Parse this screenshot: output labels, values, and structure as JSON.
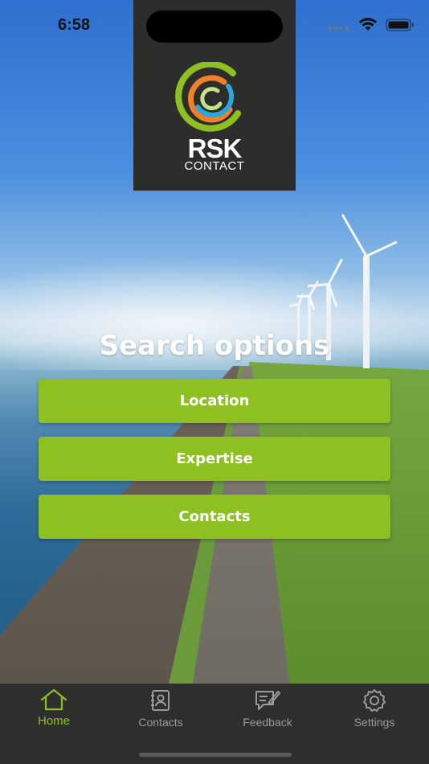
{
  "status_bar": {
    "time": "6:58"
  },
  "brand": {
    "line1": "RSK",
    "line2": "CONTACT"
  },
  "search": {
    "title": "Search options",
    "buttons": [
      {
        "label": "Location"
      },
      {
        "label": "Expertise"
      },
      {
        "label": "Contacts"
      }
    ]
  },
  "tabbar": {
    "items": [
      {
        "label": "Home",
        "icon": "home-icon",
        "active": true
      },
      {
        "label": "Contacts",
        "icon": "contacts-book-icon",
        "active": false
      },
      {
        "label": "Feedback",
        "icon": "feedback-icon",
        "active": false
      },
      {
        "label": "Settings",
        "icon": "gear-icon",
        "active": false
      }
    ]
  },
  "colors": {
    "accent": "#8fc021",
    "tabbar_bg": "#2e2e2c",
    "logo_bg": "#2d2d2b",
    "inactive": "#9a9a96"
  }
}
